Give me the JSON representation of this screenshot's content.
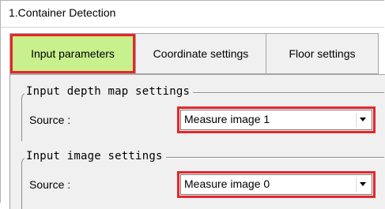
{
  "window": {
    "title": "1.Container Detection"
  },
  "tabs": [
    {
      "label": "Input parameters",
      "active": true
    },
    {
      "label": "Coordinate settings",
      "active": false
    },
    {
      "label": "Floor settings",
      "active": false
    }
  ],
  "groups": {
    "depth_map": {
      "title": "Input depth map settings",
      "source_label": "Source :",
      "source_value": "Measure image 1"
    },
    "image": {
      "title": "Input image settings",
      "source_label": "Source :",
      "source_value": "Measure image 0"
    }
  },
  "icons": {
    "dropdown": "chevron-down-icon"
  },
  "colors": {
    "active_tab": "#c8f08c",
    "highlight": "#e6262c",
    "panel": "#f0f0f0"
  }
}
